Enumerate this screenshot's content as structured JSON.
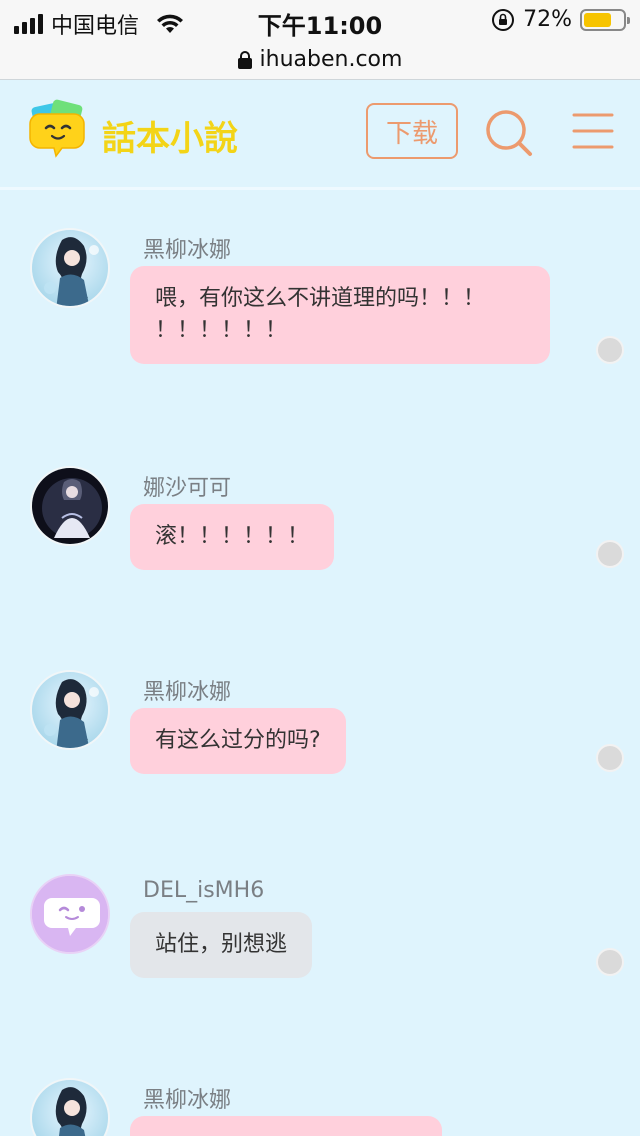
{
  "status_bar": {
    "carrier": "中国电信",
    "time": "下午11:00",
    "battery_percent": "72%",
    "battery_level": 0.72
  },
  "url_bar": {
    "url": "ihuaben.com"
  },
  "header": {
    "logo_text": "話本小說",
    "download_label": "下载",
    "icons": [
      "search-icon",
      "menu-icon"
    ],
    "accent_color": "#ec9a6e"
  },
  "messages": [
    {
      "name": "黑柳冰娜",
      "text": "喂，有你这么不讲道理的吗！！！！！！！！！",
      "line1": "喂，有你这么不讲道理的吗！！！",
      "line2": "！！！！！！",
      "style": "pink"
    },
    {
      "name": "娜沙可可",
      "text": "滚！！！！！！",
      "style": "pink"
    },
    {
      "name": "黑柳冰娜",
      "text": "有这么过分的吗?",
      "style": "pink"
    },
    {
      "name": "DEL_isMH6",
      "text": "站住，别想逃",
      "style": "gray"
    },
    {
      "name": "黑柳冰娜",
      "text": "",
      "style": "pink"
    }
  ]
}
